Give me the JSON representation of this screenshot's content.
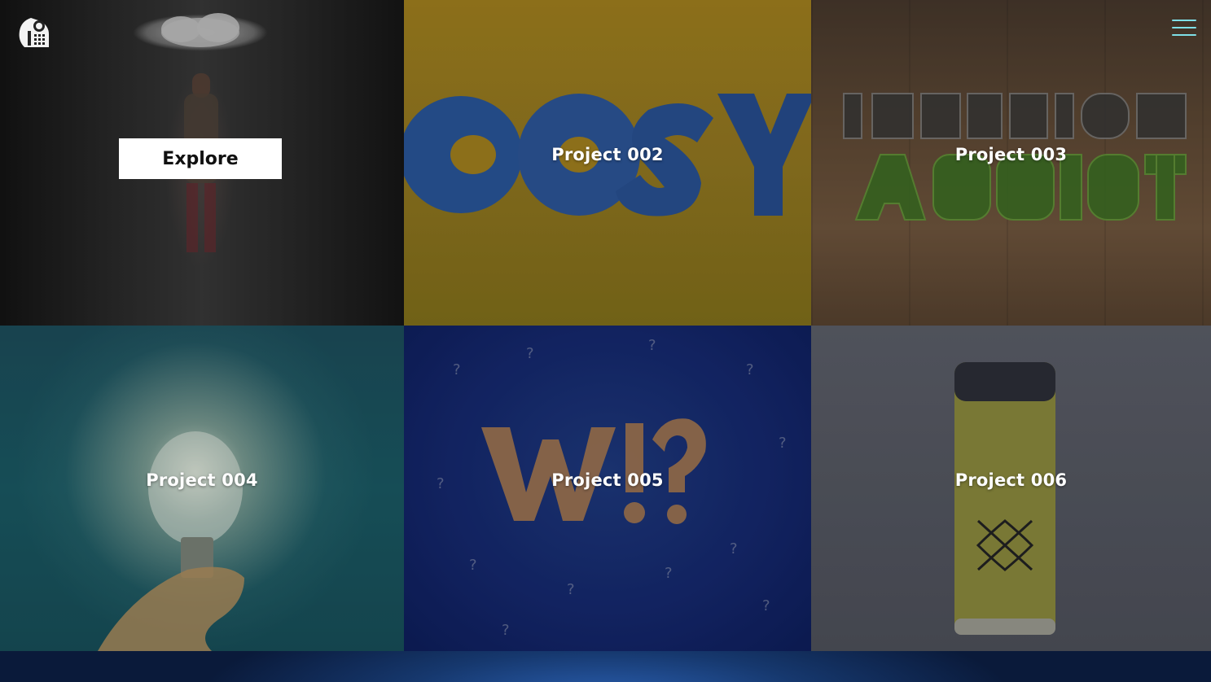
{
  "header": {
    "logo_icon": "studio-logo-icon",
    "menu_icon": "hamburger-menu-icon",
    "menu_color": "#7ee0e8"
  },
  "tiles": [
    {
      "label": "Explore"
    },
    {
      "label": "Project 002"
    },
    {
      "label": "Project 003"
    },
    {
      "label": "Project 004"
    },
    {
      "label": "Project 005"
    },
    {
      "label": "Project 006"
    }
  ]
}
